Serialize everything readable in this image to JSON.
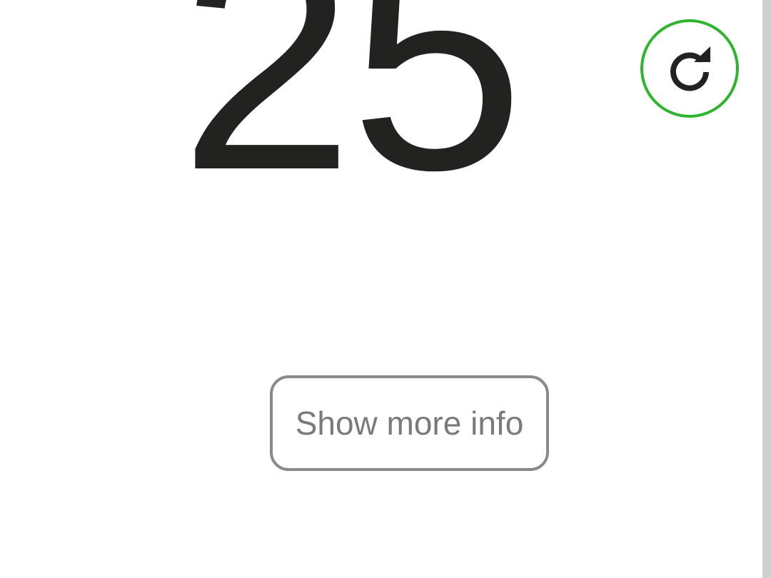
{
  "speed": {
    "value": "25"
  },
  "controls": {
    "restart_icon": "restart-icon",
    "restart_border_color": "#2db52d",
    "more_info_label": "Show more info"
  },
  "colors": {
    "text": "#222220",
    "muted": "#7a7a7a",
    "border": "#8a8a8a",
    "scrollbar": "#cfcfcf"
  }
}
